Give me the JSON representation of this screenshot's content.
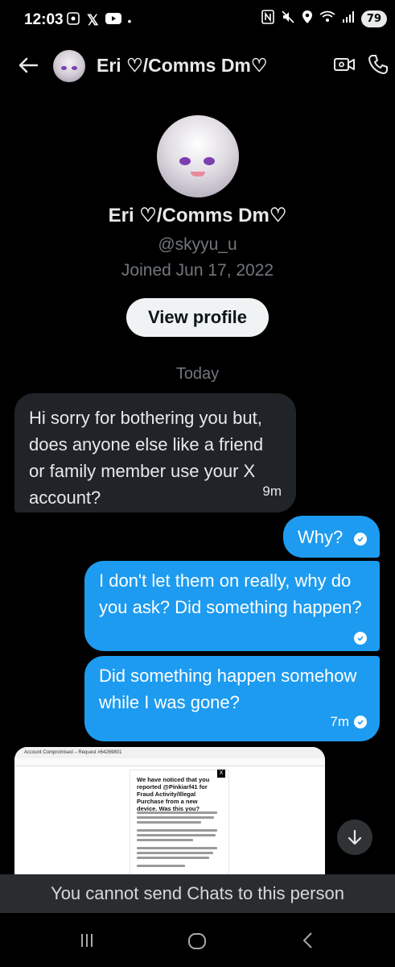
{
  "status_bar": {
    "time": "12:03",
    "battery": "79"
  },
  "header": {
    "contact_name": "Eri ♡/Comms Dm♡"
  },
  "profile": {
    "name": "Eri ♡/Comms Dm♡",
    "handle": "@skyyu_u",
    "joined": "Joined Jun 17, 2022",
    "view_profile_label": "View profile"
  },
  "conversation": {
    "day_separator": "Today",
    "messages": [
      {
        "direction": "incoming",
        "text": "Hi sorry for bothering you but, does anyone else like a friend or family member use your X account?",
        "time": "9m"
      },
      {
        "direction": "outgoing",
        "text": "Why?",
        "time": ""
      },
      {
        "direction": "outgoing",
        "text": "I don't let them on really, why do you ask? Did something happen?",
        "time": ""
      },
      {
        "direction": "outgoing",
        "text": "Did something happen somehow while I was gone?",
        "time": "7m"
      }
    ],
    "image_attachment": {
      "tab_title": "Account Compromised – Request #64269801",
      "headline": "We have noticed that you reported @Pinkiarf41 for Fraud Activity/Illegal Purchase from a new device. Was this you?"
    }
  },
  "footer": {
    "notice": "You cannot send Chats to this person"
  },
  "colors": {
    "accent": "#1d9bf0",
    "background": "#000000",
    "incoming_bubble": "#202327"
  }
}
